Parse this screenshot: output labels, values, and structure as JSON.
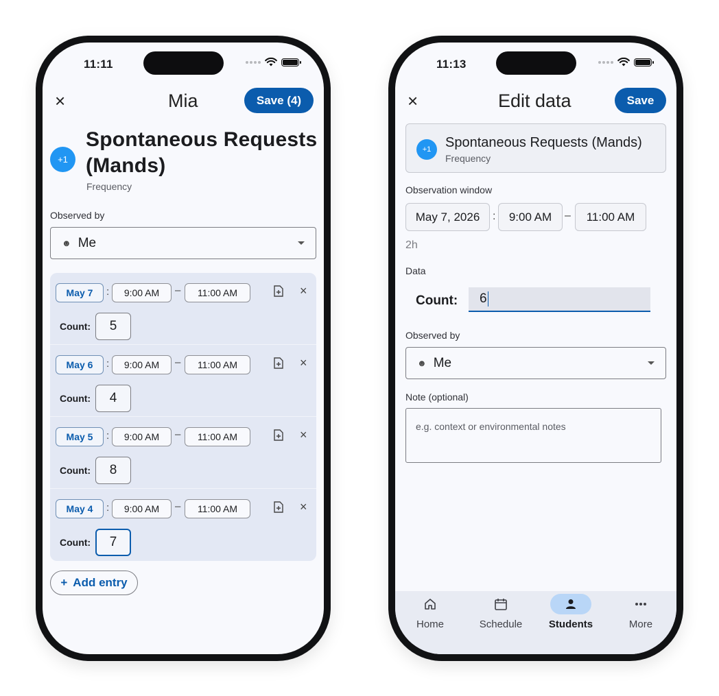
{
  "left": {
    "status_time": "11:11",
    "title": "Mia",
    "save_label": "Save (4)",
    "goal_badge": "+1",
    "goal_title_line1": "Spontaneous Requests",
    "goal_title_line2": "(Mands)",
    "goal_type": "Frequency",
    "observed_by_label": "Observed by",
    "observed_by_value": "Me",
    "count_label": "Count:",
    "entries": [
      {
        "date": "May 7",
        "start": "9:00 AM",
        "end": "11:00 AM",
        "count": "5"
      },
      {
        "date": "May 6",
        "start": "9:00 AM",
        "end": "11:00 AM",
        "count": "4"
      },
      {
        "date": "May 5",
        "start": "9:00 AM",
        "end": "11:00 AM",
        "count": "8"
      },
      {
        "date": "May 4",
        "start": "9:00 AM",
        "end": "11:00 AM",
        "count": "7"
      }
    ],
    "add_entry_label": "Add entry"
  },
  "right": {
    "status_time": "11:13",
    "title": "Edit data",
    "save_label": "Save",
    "goal_badge": "+1",
    "goal_title": "Spontaneous Requests (Mands)",
    "goal_type": "Frequency",
    "observation_window_label": "Observation window",
    "date": "May 7, 2026",
    "start": "9:00 AM",
    "end": "11:00 AM",
    "duration": "2h",
    "data_label": "Data",
    "count_label": "Count:",
    "count_value": "6",
    "observed_by_label": "Observed by",
    "observed_by_value": "Me",
    "note_label": "Note (optional)",
    "note_placeholder": "e.g. context or environmental notes",
    "nav": [
      {
        "label": "Home",
        "icon": "home-icon",
        "active": false
      },
      {
        "label": "Schedule",
        "icon": "calendar-icon",
        "active": false
      },
      {
        "label": "Students",
        "icon": "person-icon",
        "active": true
      },
      {
        "label": "More",
        "icon": "more-icon",
        "active": false
      }
    ]
  },
  "colors": {
    "primary": "#0b5cad",
    "badge": "#2196f3",
    "entry_bg": "#e3e8f4",
    "active_nav": "#b9d6f7"
  }
}
